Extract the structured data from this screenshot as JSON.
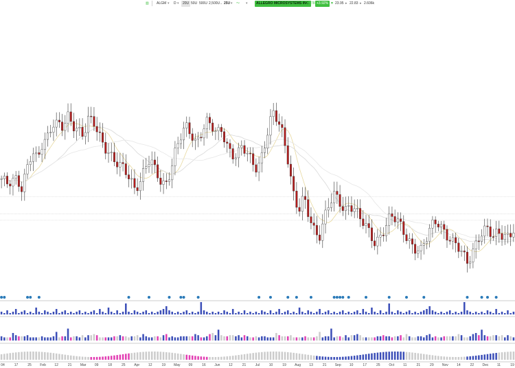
{
  "toolbar": {
    "symbol": "ALGM",
    "period": "D",
    "bar_options": [
      "20U",
      "50U",
      "500U",
      "2,500U"
    ],
    "selected_count": "25U",
    "company": "ALLEGRO MICROSYSTEMS INC.",
    "last_price": "23.78",
    "change_pct": "+3.92%",
    "high": "23.95",
    "low": "22.83",
    "volume": "2.606k"
  },
  "colors": {
    "up": "#ffffff",
    "down": "#b71c1c",
    "wick": "#333333",
    "ma_fast": "#e8d9a0",
    "ma_slow": "#d8d8d8",
    "event_dot": "#2a7ab8",
    "vol_up": "#3c4fb8",
    "vol_down": "#e23fb3",
    "vol_neutral": "#cccccc",
    "bg": "#ffffff"
  },
  "chart_data": {
    "type": "candlestick",
    "x_labels": [
      "04",
      "17",
      "25",
      "Feb",
      "12",
      "21",
      "Mar",
      "09",
      "18",
      "25",
      "Apr",
      "12",
      "19",
      "May",
      "09",
      "16",
      "Jun",
      "12",
      "21",
      "Jul",
      "10",
      "19",
      "Aug",
      "13",
      "21",
      "Sep",
      "10",
      "17",
      "25",
      "Oct",
      "11",
      "21",
      "29",
      "Nov",
      "14",
      "22",
      "Dec",
      "11",
      "19"
    ],
    "reference_levels": [
      37.2,
      34.0,
      32.8
    ],
    "ylim": [
      20,
      60
    ],
    "grid": false,
    "closes": [
      40.0,
      39.5,
      40.5,
      41.2,
      38.9,
      42.3,
      45.1,
      44.0,
      47.6,
      48.9,
      51.2,
      50.5,
      49.8,
      52.1,
      51.0,
      50.3,
      49.0,
      51.5,
      50.8,
      48.7,
      47.3,
      45.9,
      44.2,
      42.8,
      41.9,
      40.7,
      39.1,
      40.4,
      42.6,
      44.0,
      41.8,
      40.2,
      39.6,
      42.5,
      45.9,
      48.2,
      50.0,
      49.1,
      47.7,
      49.6,
      51.3,
      50.2,
      48.6,
      49.9,
      47.4,
      45.5,
      44.9,
      46.2,
      45.0,
      43.8,
      42.9,
      45.7,
      49.3,
      52.6,
      51.2,
      48.9,
      44.5,
      38.1,
      34.4,
      36.6,
      33.5,
      31.2,
      30.0,
      33.4,
      35.8,
      37.1,
      36.0,
      34.6,
      36.3,
      35.2,
      33.1,
      31.4,
      29.9,
      28.6,
      30.3,
      31.9,
      33.4,
      32.6,
      31.5,
      30.1,
      28.7,
      27.5,
      26.8,
      29.0,
      31.7,
      33.2,
      31.8,
      30.0,
      28.3,
      27.6,
      26.5,
      25.4,
      27.2,
      29.3,
      30.1,
      30.8,
      29.6,
      31.2,
      30.4,
      29.7,
      30.5
    ],
    "events": [
      0,
      1,
      9,
      10,
      13,
      44,
      51,
      58,
      62,
      63,
      68,
      89,
      93,
      99,
      102,
      107,
      115,
      116,
      117,
      118,
      120,
      126,
      134,
      140,
      146,
      161,
      166,
      168,
      171
    ],
    "volume": [
      2,
      1,
      3,
      1,
      2,
      4,
      1,
      2,
      3,
      1,
      2,
      1,
      5,
      2,
      1,
      3,
      2,
      1,
      2,
      4,
      1,
      2,
      3,
      1,
      2,
      1,
      2,
      3,
      1,
      2,
      1,
      2,
      3,
      1,
      4,
      2,
      1,
      5,
      2,
      1,
      3,
      1,
      2,
      8,
      2,
      1,
      3,
      2,
      1,
      2,
      3,
      1,
      2,
      1,
      2,
      3,
      4,
      6,
      3,
      2,
      1,
      2,
      1,
      2,
      3,
      1,
      2,
      1,
      2,
      9,
      3,
      2,
      1,
      2,
      1,
      2,
      1,
      3,
      2,
      1,
      4,
      1,
      2,
      1,
      3,
      1,
      2,
      1,
      2,
      1,
      3
    ]
  }
}
